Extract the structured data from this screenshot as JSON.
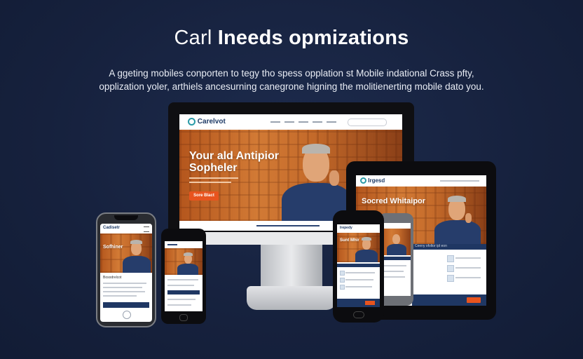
{
  "headline": {
    "part1": "Carl ",
    "part2": "Ineeds opmizations"
  },
  "subtitle": {
    "line1": "A ggeting mobiles conporten to tegy tho spess opplation st Mobile indational Crass pfty,",
    "line2": "opplization yoler, arthiels ancesurning canegrone higning the molitienerting mobile dato you."
  },
  "monitor": {
    "logo": "Carelvot",
    "nav_items": [
      "",
      "",
      "",
      "",
      ""
    ],
    "hero_title_line1": "Your ald Antipior",
    "hero_title_line2": "Sopheler",
    "cta": "Sore Blact"
  },
  "tablet": {
    "logo": "Irgesd",
    "hero_title": "Socred Whitaipor",
    "section_title": "Ceeny ofoltor ipl eon"
  },
  "phones": {
    "left_logo": "Cadisetr",
    "left_hero": "Sofhiner",
    "left_section": "Bosodrelcot",
    "mid_logo": "",
    "right_logo": "Irepedy",
    "right_hero": "Sunt Mhir"
  },
  "colors": {
    "background": "#16213d",
    "hero_orange": "#c46a2a",
    "cta_orange": "#e8541e",
    "navy": "#1f3763"
  }
}
